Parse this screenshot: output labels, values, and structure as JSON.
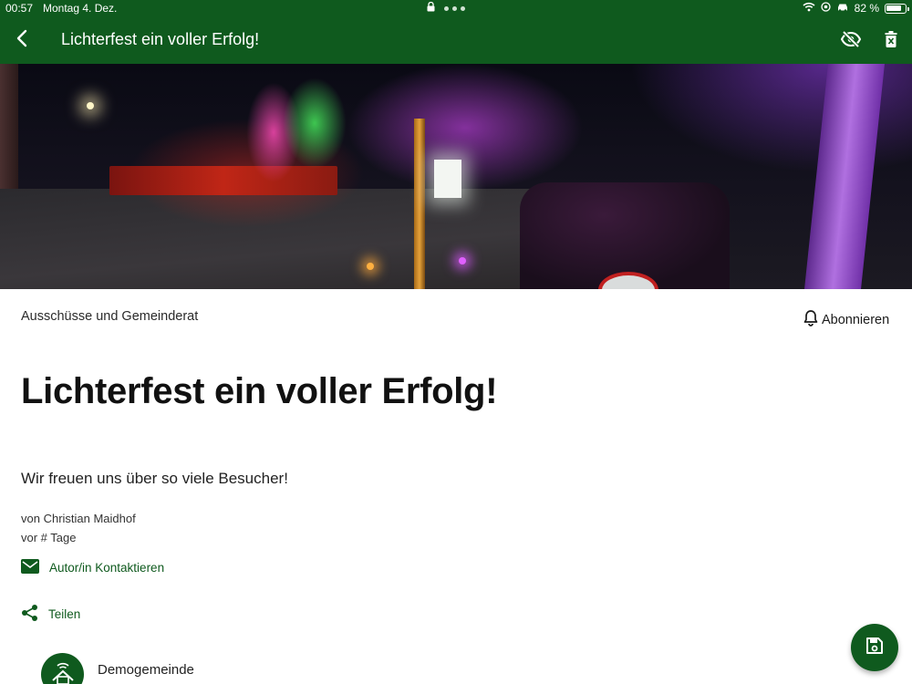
{
  "statusbar": {
    "time": "00:57",
    "date": "Montag 4. Dez.",
    "battery": "82 %",
    "battery_level": 0.82
  },
  "appbar": {
    "title": "Lichterfest ein voller Erfolg!",
    "back_icon": "chevron-left-icon",
    "hide_icon": "eye-off-icon",
    "delete_icon": "trash-icon"
  },
  "article": {
    "category": "Ausschüsse und Gemeinderat",
    "subscribe_label": "Abonnieren",
    "title": "Lichterfest ein voller Erfolg!",
    "subtitle": "Wir freuen uns über so viele Besucher!",
    "author": "von Christian Maidhof",
    "time_ago": "vor # Tage",
    "contact_label": "Autor/in Kontaktieren",
    "share_label": "Teilen",
    "organization": "Demogemeinde"
  },
  "colors": {
    "primary": "#0f5a1e",
    "text": "#1a1a1a",
    "background": "#ffffff"
  },
  "fab": {
    "icon": "save-icon"
  }
}
